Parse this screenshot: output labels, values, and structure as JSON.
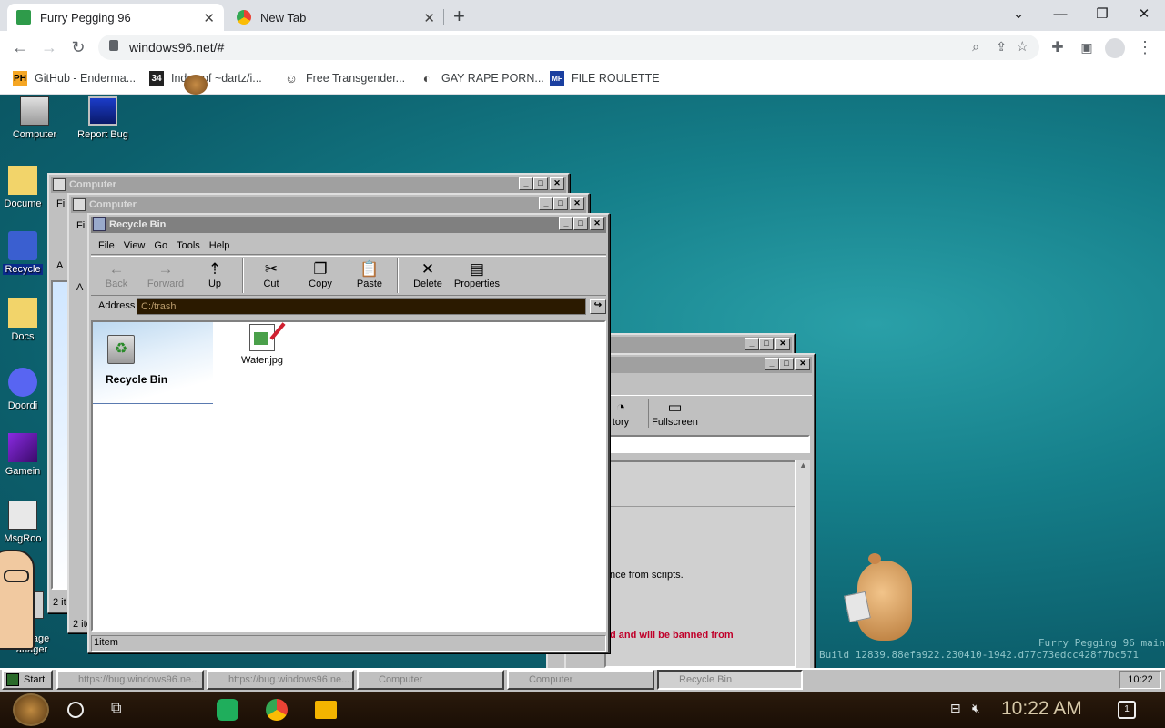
{
  "browser": {
    "tabs": [
      {
        "title": "Furry Pegging 96",
        "active": true
      },
      {
        "title": "New Tab",
        "active": false
      }
    ],
    "new_tab": "+",
    "window_controls": [
      "⌄",
      "—",
      "❐",
      "✕"
    ],
    "url": "windows96.net/#",
    "bookmarks": [
      {
        "label": "GitHub - Enderma...",
        "icon": "PH"
      },
      {
        "label": "Index of ~dartz/i...",
        "icon": "34"
      },
      {
        "label": "Free Transgender...",
        "icon": "☺"
      },
      {
        "label": "GAY RAPE PORN...",
        "icon": "◐"
      },
      {
        "label": "FILE ROULETTE",
        "icon": "MF"
      }
    ]
  },
  "desktop": {
    "icons": [
      "Computer",
      "Report Bug",
      "Docume",
      "Recycle",
      "Docs",
      "Doordi",
      "Gamein",
      "MsgRoo",
      "ackage\nanager"
    ],
    "watermark": [
      "Furry Pegging 96 main",
      "Build 12839.88efa922.230410-1942.d77c73edcc428f7bc571"
    ]
  },
  "windows": {
    "back1_title": "Computer",
    "back2_title": "Computer",
    "back1_menu": "Fi",
    "back2_menu": "Fi",
    "back1_addr": "A",
    "back2_addr": "A",
    "back1_status": "2 it",
    "back2_status": "2 ite",
    "bug_toolbar": [
      "tory",
      "Fullscreen"
    ],
    "bug_texts": [
      "nce from scripts.",
      "d and will be banned from"
    ]
  },
  "recycle": {
    "title": "Recycle Bin",
    "menu": [
      "File",
      "View",
      "Go",
      "Tools",
      "Help"
    ],
    "toolbar": [
      {
        "label": "Back",
        "icon": "←",
        "disabled": true
      },
      {
        "label": "Forward",
        "icon": "→",
        "disabled": true
      },
      {
        "label": "Up",
        "icon": "⇡",
        "disabled": false
      },
      {
        "label": "Cut",
        "icon": "✂",
        "disabled": false
      },
      {
        "label": "Copy",
        "icon": "❐",
        "disabled": false
      },
      {
        "label": "Paste",
        "icon": "📋",
        "disabled": false
      },
      {
        "label": "Delete",
        "icon": "✕",
        "disabled": false
      },
      {
        "label": "Properties",
        "icon": "▤",
        "disabled": false
      }
    ],
    "address_label": "Address",
    "address": "C:/trash",
    "sidebar_title": "Recycle Bin",
    "files": [
      {
        "name": "Water.jpg"
      }
    ],
    "status": "1item"
  },
  "taskbar": {
    "start": "Start",
    "buttons": [
      "https://bug.windows96.ne...",
      "https://bug.windows96.ne...",
      "Computer",
      "Computer",
      "Recycle Bin"
    ],
    "clock": "10:22"
  },
  "shelf": {
    "time": "10:22 AM",
    "notif": "1"
  }
}
